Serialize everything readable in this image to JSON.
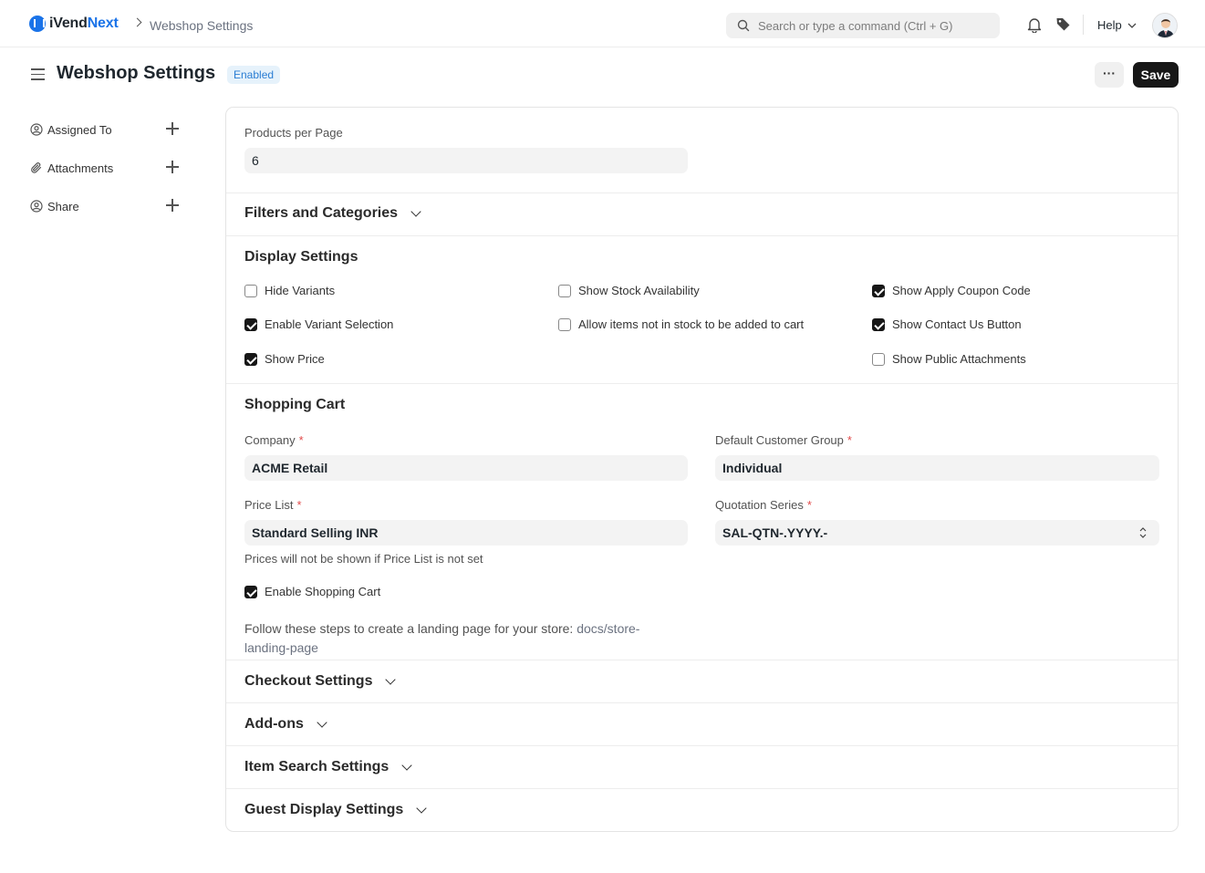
{
  "app": {
    "brand_prefix": "iVend",
    "brand_suffix": "Next",
    "breadcrumb": "Webshop Settings"
  },
  "search": {
    "placeholder": "Search or type a command (Ctrl + G)"
  },
  "nav": {
    "help": "Help"
  },
  "page": {
    "title": "Webshop Settings",
    "status": "Enabled",
    "more": "···",
    "save": "Save"
  },
  "sidebar": {
    "items": [
      {
        "label": "Assigned To",
        "icon": "user-circle-icon"
      },
      {
        "label": "Attachments",
        "icon": "paperclip-icon"
      },
      {
        "label": "Share",
        "icon": "share-user-icon"
      }
    ]
  },
  "form": {
    "products_per_page": {
      "label": "Products per Page",
      "value": "6"
    },
    "filters_section": "Filters and Categories",
    "display_section": "Display Settings",
    "checkboxes": [
      {
        "label": "Hide Variants",
        "checked": false
      },
      {
        "label": "Enable Variant Selection",
        "checked": true
      },
      {
        "label": "Show Price",
        "checked": true
      },
      {
        "label": "Show Stock Availability",
        "checked": false
      },
      {
        "label": "Allow items not in stock to be added to cart",
        "checked": false
      },
      {
        "label": "Show Apply Coupon Code",
        "checked": true
      },
      {
        "label": "Show Contact Us Button",
        "checked": true
      },
      {
        "label": "Show Public Attachments",
        "checked": false
      }
    ],
    "shopping_cart_section": "Shopping Cart",
    "company": {
      "label": "Company",
      "value": "ACME Retail"
    },
    "customer_group": {
      "label": "Default Customer Group",
      "value": "Individual"
    },
    "price_list": {
      "label": "Price List",
      "value": "Standard Selling INR",
      "hint": "Prices will not be shown if Price List is not set"
    },
    "quotation_series": {
      "label": "Quotation Series",
      "value": "SAL-QTN-.YYYY.-"
    },
    "enable_cart": {
      "label": "Enable Shopping Cart",
      "checked": true
    },
    "landing_text": "Follow these steps to create a landing page for your store:",
    "landing_link_1": "docs/store-",
    "landing_link_2": "landing-page",
    "landing_line1": "Follow these steps to create a landing page for your store: docs/store-",
    "collapsed_sections": [
      "Checkout Settings",
      "Add-ons",
      "Item Search Settings",
      "Guest Display Settings"
    ]
  },
  "required_mark": "*"
}
